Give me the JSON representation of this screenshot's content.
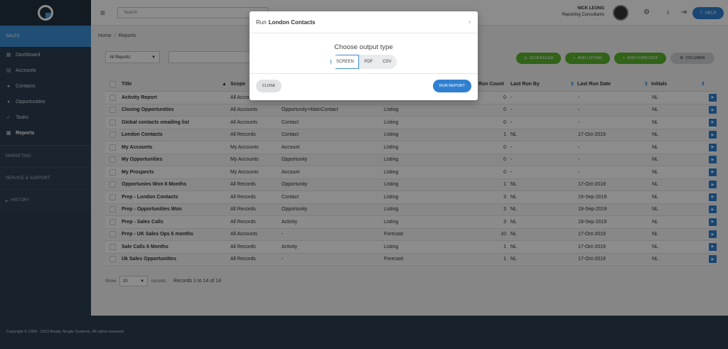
{
  "search": {
    "placeholder": "Search"
  },
  "user": {
    "name": "NICK LEONG",
    "company": "Reporting Consultants"
  },
  "help_label": "HELP",
  "sidebar": {
    "section": "SALES",
    "items": [
      {
        "label": "Dashboard",
        "icon": "dashboard-icon"
      },
      {
        "label": "Accounts",
        "icon": "accounts-icon"
      },
      {
        "label": "Contacts",
        "icon": "contacts-icon"
      },
      {
        "label": "Opportunities",
        "icon": "opportunities-icon"
      },
      {
        "label": "Tasks",
        "icon": "tasks-icon"
      },
      {
        "label": "Reports",
        "icon": "reports-icon"
      }
    ],
    "marketing": "MARKETING",
    "service": "SERVICE & SUPPORT",
    "history": "HISTORY"
  },
  "breadcrumb": {
    "home": "Home",
    "sep": "/",
    "current": "Reports"
  },
  "filter": {
    "selected": "All Reports"
  },
  "buttons": {
    "scheduled": "SCHEDULED",
    "add_listing": "ADD LISTING",
    "add_forecast": "ADD FORECAST",
    "columns": "COLUMNS"
  },
  "columns": {
    "title": "Title",
    "scope": "Scope",
    "run_count": "Run Count",
    "last_run_by": "Last Run By",
    "last_run_date": "Last Run Date",
    "initials": "Initials"
  },
  "rows": [
    {
      "title": "Activity Report",
      "scope": "All Accounts",
      "base": "",
      "type": "",
      "count": "0",
      "by": "-",
      "date": "-",
      "init": "NL"
    },
    {
      "title": "Closing Opportunities",
      "scope": "All Accounts",
      "base": "Opportunity+MainContact",
      "type": "Listing",
      "count": "0",
      "by": "-",
      "date": "-",
      "init": "NL"
    },
    {
      "title": "Global contacts emailing list",
      "scope": "All Accounts",
      "base": "Contact",
      "type": "Listing",
      "count": "0",
      "by": "-",
      "date": "-",
      "init": "NL"
    },
    {
      "title": "London Contacts",
      "scope": "All Records",
      "base": "Contact",
      "type": "Listing",
      "count": "1",
      "by": "NL",
      "date": "17-Oct-2019",
      "init": "NL"
    },
    {
      "title": "My Accounts",
      "scope": "My Accounts",
      "base": "Account",
      "type": "Listing",
      "count": "0",
      "by": "-",
      "date": "-",
      "init": "NL"
    },
    {
      "title": "My Opportunities",
      "scope": "My Accounts",
      "base": "Opportunity",
      "type": "Listing",
      "count": "0",
      "by": "-",
      "date": "-",
      "init": "NL"
    },
    {
      "title": "My Prospects",
      "scope": "My Accounts",
      "base": "Account",
      "type": "Listing",
      "count": "0",
      "by": "-",
      "date": "-",
      "init": "NL"
    },
    {
      "title": "Opportunies Won 6 Months",
      "scope": "All Records",
      "base": "Opportunity",
      "type": "Listing",
      "count": "1",
      "by": "NL",
      "date": "17-Oct-2019",
      "init": "NL"
    },
    {
      "title": "Prep - London Contacts",
      "scope": "All Records",
      "base": "Contact",
      "type": "Listing",
      "count": "3",
      "by": "NL",
      "date": "19-Sep-2019",
      "init": "NL"
    },
    {
      "title": "Prep - Opportunities Won",
      "scope": "All Records",
      "base": "Opportunity",
      "type": "Listing",
      "count": "3",
      "by": "NL",
      "date": "19-Sep-2019",
      "init": "NL"
    },
    {
      "title": "Prep - Sales Calls",
      "scope": "All Records",
      "base": "Activity",
      "type": "Listing",
      "count": "3",
      "by": "NL",
      "date": "19-Sep-2019",
      "init": "NL"
    },
    {
      "title": "Prep - UK Sales Ops 6 months",
      "scope": "All Accounts",
      "base": "-",
      "type": "Forecast",
      "count": "10",
      "by": "NL",
      "date": "17-Oct-2019",
      "init": "NL"
    },
    {
      "title": "Sale Calls 6 Months",
      "scope": "All Records",
      "base": "Activity",
      "type": "Listing",
      "count": "1",
      "by": "NL",
      "date": "17-Oct-2019",
      "init": "NL"
    },
    {
      "title": "Uk Sales Opportunities",
      "scope": "All Records",
      "base": "-",
      "type": "Forecast",
      "count": "1",
      "by": "NL",
      "date": "17-Oct-2019",
      "init": "NL"
    }
  ],
  "pager": {
    "show": "Show",
    "size": "20",
    "records": "records",
    "info": "Records 1 to 14 of 14"
  },
  "footer": "Copyright © 2004 - 2019 Really Simple Systems. All rights reserved.",
  "modal": {
    "prefix": "Run",
    "report": "London Contacts",
    "close_x": "×",
    "prompt": "Choose output type",
    "options": [
      "SCREEN",
      "PDF",
      "CSV"
    ],
    "close_label": "CLOSE",
    "run_label": "RUN REPORT"
  }
}
